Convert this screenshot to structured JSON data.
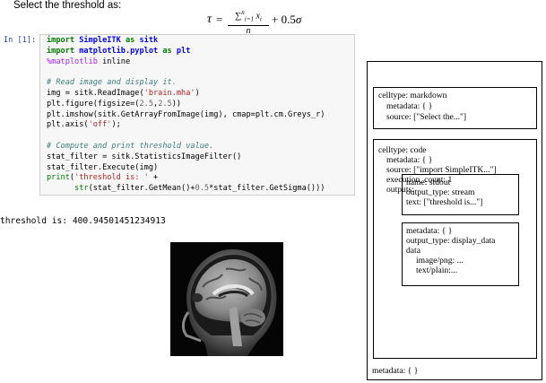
{
  "notebook": {
    "markdown_heading": "Select the threshold as:",
    "formula": {
      "lhs": "τ",
      "eq": "=",
      "sum_symbol": "∑",
      "sum_upper": "n",
      "sum_lower": "i=1",
      "numerator_var": "x",
      "numerator_sub": "i",
      "denominator": "n",
      "plus": "+ 0.5",
      "sigma": "σ"
    },
    "prompt": "In [1]:",
    "output": "threshold is: 400.94501451234913"
  },
  "diagram": {
    "cell1": {
      "celltype": "celltype: markdown",
      "metadata": "metadata: { }",
      "source": "source: [\"Select the...\"]"
    },
    "cell2": {
      "celltype": "celltype: code",
      "metadata": "metadata: { }",
      "source": "source: [\"import SimpleITK...\"]",
      "execution_count": "execution_count: 1",
      "outputs": "outputs:"
    },
    "output1": {
      "name": "name: stdout",
      "output_type": "output_type: stream",
      "text": "text: [\"threshold is...\"]"
    },
    "output2": {
      "metadata": "metadata: { }",
      "output_type": "output_type: display_data",
      "data": "data",
      "image": "image/png: ...",
      "text": "text/plain:..."
    },
    "notebook_metadata": "metadata: { }"
  },
  "colors": {
    "keyword": "#008000",
    "module": "#0000ff",
    "comment": "#408080",
    "string": "#ba2121",
    "prompt": "#303f9f"
  }
}
